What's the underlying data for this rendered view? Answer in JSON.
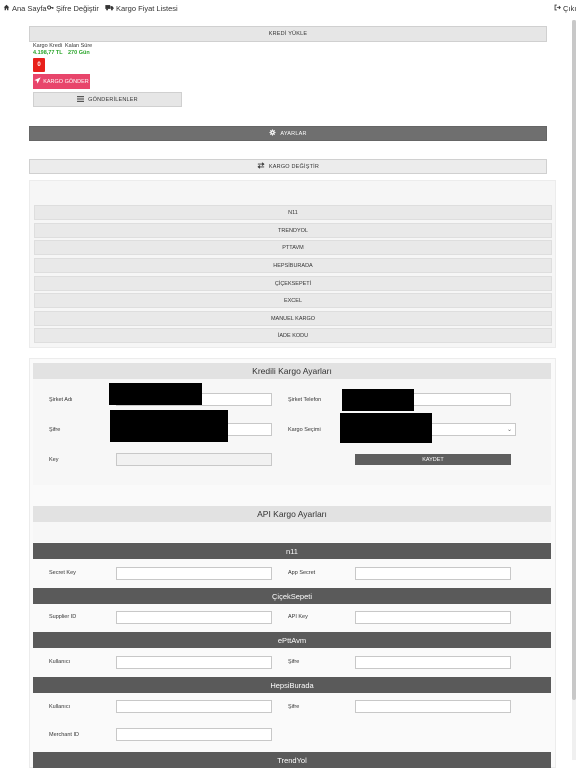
{
  "nav": {
    "home": "Ana Sayfa",
    "password": "Şifre Değiştir",
    "price_list": "Kargo Fiyat Listesi",
    "logout": "Çıkış"
  },
  "buttons": {
    "credit_upload": "KREDİ YÜKLE",
    "send_cargo": "KARGO GÖNDER",
    "sent": "GÖNDERİLENLER",
    "settings": "AYARLAR",
    "change_cargo": "KARGO DEĞİŞTİR",
    "save": "KAYDET"
  },
  "stats": {
    "credit_label": "Kargo Kredi",
    "credit_value": "4.198,77 TL",
    "remaining_label": "Kalan Süre",
    "remaining_value": "270 Gün",
    "badge": "0"
  },
  "channels": [
    "N11",
    "TRENDYOL",
    "PTTAVM",
    "HEPSİBURADA",
    "ÇİÇEKSEPETİ",
    "EXCEL",
    "MANUEL KARGO",
    "İADE KODU"
  ],
  "credit_settings": {
    "title": "Kredili Kargo Ayarları",
    "company_name": "Şirket Adı",
    "company_phone": "Şirket Telefon",
    "password": "Şifre",
    "cargo_select": "Kargo Seçimi",
    "key": "Key"
  },
  "api_settings": {
    "title": "API Kargo Ayarları",
    "providers": [
      {
        "name": "n11",
        "f1": "Secret Key",
        "f2": "App Secret"
      },
      {
        "name": "ÇiçekSepeti",
        "f1": "Supplier ID",
        "f2": "API Key"
      },
      {
        "name": "ePttAvm",
        "f1": "Kullanıcı",
        "f2": "Şifre"
      },
      {
        "name": "HepsiBurada",
        "f1": "Kullanıcı",
        "f2": "Şifre",
        "f3": "Merchant ID"
      },
      {
        "name": "TrendYol"
      }
    ]
  },
  "icons": {
    "home": "home-icon",
    "password": "key-icon",
    "truck": "truck-icon",
    "logout": "sign-out-icon",
    "send": "paper-plane-icon",
    "list": "list-icon",
    "gear": "gear-icon",
    "exchange": "exchange-icon"
  }
}
